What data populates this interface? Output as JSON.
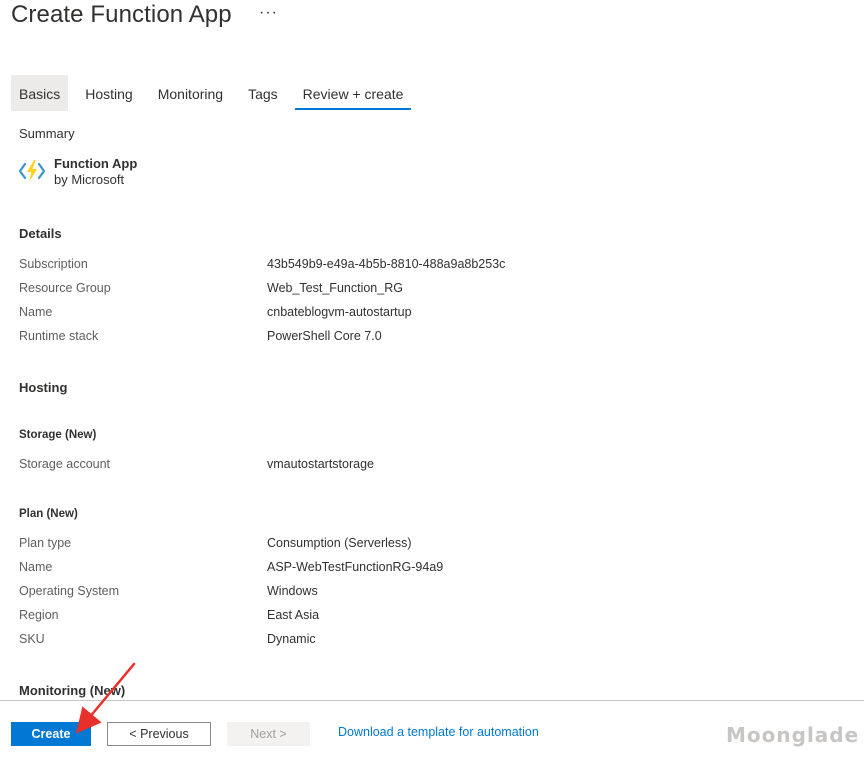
{
  "header": {
    "title": "Create Function App",
    "more": "···"
  },
  "tabs": [
    {
      "label": "Basics"
    },
    {
      "label": "Hosting"
    },
    {
      "label": "Monitoring"
    },
    {
      "label": "Tags"
    },
    {
      "label": "Review + create"
    }
  ],
  "summary": {
    "label": "Summary",
    "product_name": "Function App",
    "product_vendor": "by Microsoft"
  },
  "details": {
    "heading": "Details",
    "rows": [
      {
        "key": "Subscription",
        "value": "43b549b9-e49a-4b5b-8810-488a9a8b253c"
      },
      {
        "key": "Resource Group",
        "value": "Web_Test_Function_RG"
      },
      {
        "key": "Name",
        "value": "cnbateblogvm-autostartup"
      },
      {
        "key": "Runtime stack",
        "value": "PowerShell Core 7.0"
      }
    ]
  },
  "hosting": {
    "heading": "Hosting",
    "storage": {
      "heading": "Storage (New)",
      "rows": [
        {
          "key": "Storage account",
          "value": "vmautostartstorage"
        }
      ]
    },
    "plan": {
      "heading": "Plan (New)",
      "rows": [
        {
          "key": "Plan type",
          "value": "Consumption (Serverless)"
        },
        {
          "key": "Name",
          "value": "ASP-WebTestFunctionRG-94a9"
        },
        {
          "key": "Operating System",
          "value": "Windows"
        },
        {
          "key": "Region",
          "value": "East Asia"
        },
        {
          "key": "SKU",
          "value": "Dynamic"
        }
      ]
    }
  },
  "monitoring": {
    "heading": "Monitoring (New)"
  },
  "footer": {
    "create_label": "Create",
    "previous_label": "< Previous",
    "next_label": "Next >",
    "template_link": "Download a template for automation",
    "watermark": "Moonglade"
  },
  "colors": {
    "accent": "#0078d4",
    "arrow": "#e8302a"
  },
  "icons": {
    "product": "function-app-lightning-icon"
  }
}
